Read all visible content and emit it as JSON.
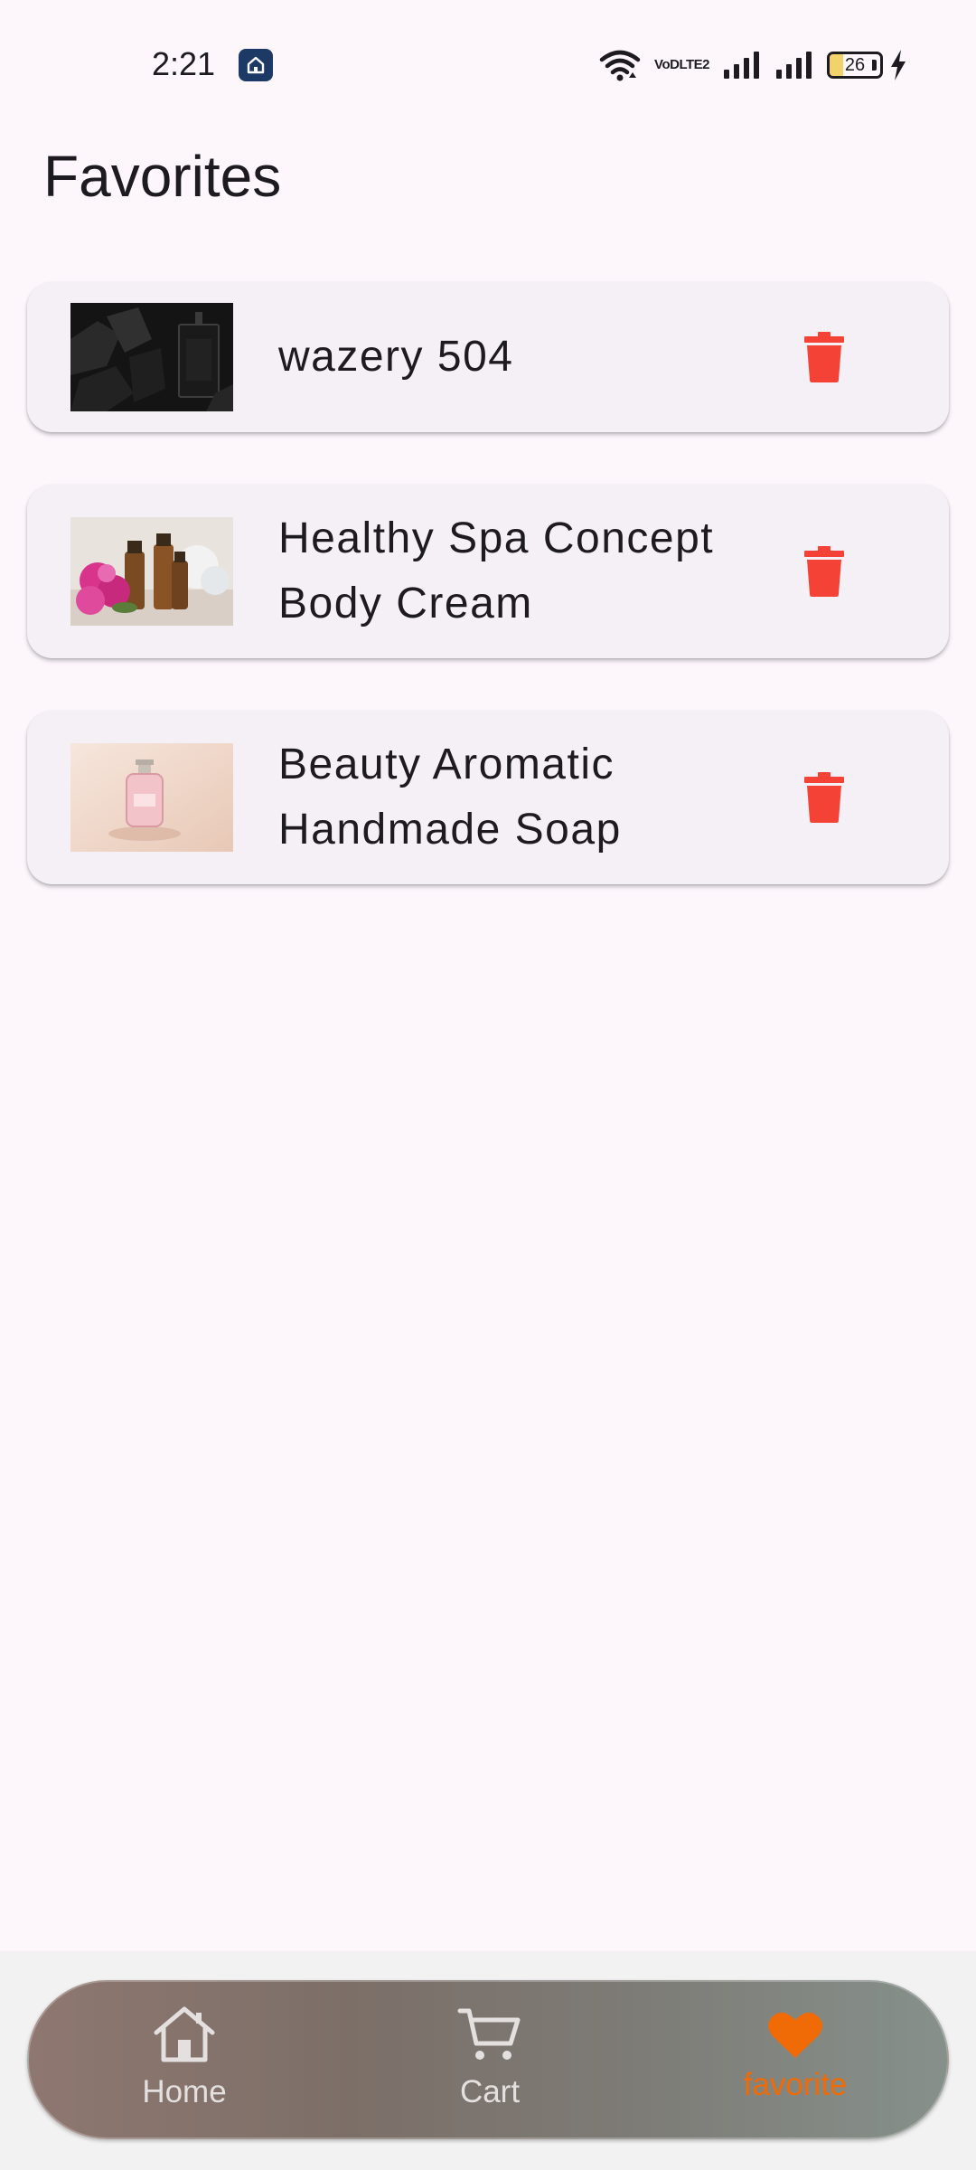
{
  "status_bar": {
    "time": "2:21",
    "notification_icon": "home-app-icon",
    "icons": [
      "wifi-icon",
      "volte-icon",
      "signal-icon",
      "signal-icon",
      "battery-icon",
      "charging-icon"
    ],
    "volte_top": "VoD",
    "volte_bottom": "LTE2",
    "battery_level": "26"
  },
  "page": {
    "title": "Favorites"
  },
  "favorites": [
    {
      "name": "wazery 504",
      "thumbnail": "dark-perfume-bottle-image",
      "delete_icon": "trash-icon"
    },
    {
      "name": "Healthy Spa Concept Body Cream",
      "thumbnail": "essential-oils-flowers-image",
      "delete_icon": "trash-icon"
    },
    {
      "name": "Beauty Aromatic Handmade Soap",
      "thumbnail": "pink-perfume-bottle-image",
      "delete_icon": "trash-icon"
    }
  ],
  "bottom_nav": {
    "items": [
      {
        "label": "Home",
        "icon": "home-icon",
        "active": false
      },
      {
        "label": "Cart",
        "icon": "cart-icon",
        "active": false
      },
      {
        "label": "favorite",
        "icon": "heart-icon",
        "active": true
      }
    ]
  },
  "colors": {
    "background": "#fdf7fc",
    "card": "#f4f0f5",
    "delete": "#f44336",
    "active_nav": "#f06a05",
    "inactive_nav": "#e3e0df"
  }
}
